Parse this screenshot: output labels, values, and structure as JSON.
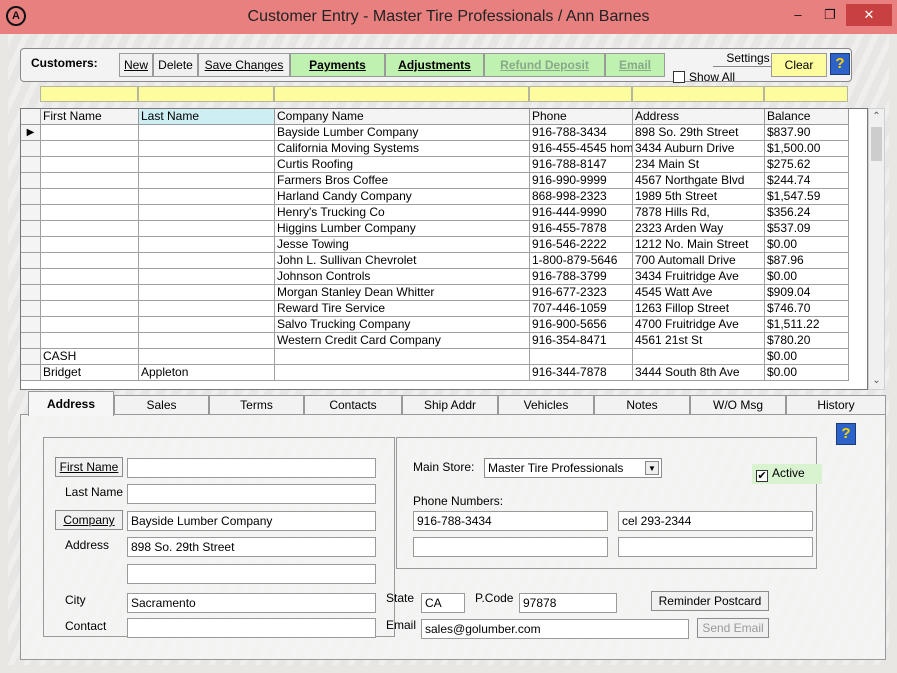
{
  "window": {
    "title": "Customer Entry - Master Tire Professionals / Ann Barnes",
    "app_icon": "A",
    "minimize": "–",
    "maximize": "❐",
    "close": "✕"
  },
  "toolbar": {
    "customers_label": "Customers:",
    "new": "New",
    "delete": "Delete",
    "save_changes": "Save Changes",
    "payments": "Payments",
    "adjustments": "Adjustments",
    "refund_deposit": "Refund Deposit",
    "email": "Email",
    "settings": "Settings",
    "show_all": "Show All",
    "clear": "Clear",
    "help": "?"
  },
  "grid": {
    "columns": [
      "",
      "First Name",
      "Last Name",
      "Company Name",
      "Phone",
      "Address",
      "Balance"
    ],
    "current_row_marker": "▶",
    "rows": [
      {
        "first": "",
        "last": "",
        "company": "Bayside Lumber Company",
        "phone": "916-788-3434",
        "address": "898 So. 29th Street",
        "balance": "$837.90"
      },
      {
        "first": "",
        "last": "",
        "company": "California Moving Systems",
        "phone": "916-455-4545 hom",
        "address": "3434 Auburn Drive",
        "balance": "$1,500.00"
      },
      {
        "first": "",
        "last": "",
        "company": "Curtis Roofing",
        "phone": "916-788-8147",
        "address": "234 Main St",
        "balance": "$275.62"
      },
      {
        "first": "",
        "last": "",
        "company": "Farmers Bros Coffee",
        "phone": "916-990-9999",
        "address": "4567 Northgate Blvd",
        "balance": "$244.74"
      },
      {
        "first": "",
        "last": "",
        "company": "Harland Candy Company",
        "phone": "868-998-2323",
        "address": "1989 5th Street",
        "balance": "$1,547.59"
      },
      {
        "first": "",
        "last": "",
        "company": "Henry's Trucking  Co",
        "phone": "916-444-9990",
        "address": "7878 Hills Rd,",
        "balance": "$356.24"
      },
      {
        "first": "",
        "last": "",
        "company": "Higgins Lumber Company",
        "phone": "916-455-7878",
        "address": "2323 Arden Way",
        "balance": "$537.09"
      },
      {
        "first": "",
        "last": "",
        "company": "Jesse Towing",
        "phone": "916-546-2222",
        "address": "1212 No. Main Street",
        "balance": "$0.00"
      },
      {
        "first": "",
        "last": "",
        "company": "John L. Sullivan Chevrolet",
        "phone": "1-800-879-5646",
        "address": "700 Automall Drive",
        "balance": "$87.96"
      },
      {
        "first": "",
        "last": "",
        "company": "Johnson Controls",
        "phone": "916-788-3799",
        "address": "3434 Fruitridge Ave",
        "balance": "$0.00"
      },
      {
        "first": "",
        "last": "",
        "company": "Morgan Stanley Dean Whitter",
        "phone": "916-677-2323",
        "address": "4545 Watt Ave",
        "balance": "$909.04"
      },
      {
        "first": "",
        "last": "",
        "company": "Reward Tire Service",
        "phone": "707-446-1059",
        "address": "1263 Fillop Street",
        "balance": "$746.70"
      },
      {
        "first": "",
        "last": "",
        "company": "Salvo Trucking Company",
        "phone": "916-900-5656",
        "address": "4700 Fruitridge Ave",
        "balance": "$1,511.22"
      },
      {
        "first": "",
        "last": "",
        "company": "Western Credit Card Company",
        "phone": "916-354-8471",
        "address": "4561 21st St",
        "balance": "$780.20"
      },
      {
        "first": "CASH",
        "last": "",
        "company": "",
        "phone": "",
        "address": "",
        "balance": "$0.00"
      },
      {
        "first": "Bridget",
        "last": "Appleton",
        "company": "",
        "phone": "916-344-7878",
        "address": "3444 South 8th Ave",
        "balance": "$0.00"
      }
    ]
  },
  "tabs": [
    "Address",
    "Sales",
    "Terms",
    "Contacts",
    "Ship Addr",
    "Vehicles",
    "Notes",
    "W/O Msg",
    "History"
  ],
  "address_form": {
    "first_name_btn": "First Name",
    "last_name_label": "Last Name",
    "company_btn": "Company",
    "address_label": "Address",
    "city_label": "City",
    "contact_label": "Contact",
    "state_label": "State",
    "pcode_label": "P.Code",
    "email_label": "Email",
    "main_store_label": "Main Store:",
    "phone_numbers_label": "Phone Numbers:",
    "active_label": "Active",
    "reminder_postcard": "Reminder Postcard",
    "send_email": "Send Email",
    "values": {
      "first_name": "",
      "last_name": "",
      "company": "Bayside Lumber Company",
      "address1": "898 So. 29th Street",
      "address2": "",
      "city": "Sacramento",
      "contact": "",
      "state": "CA",
      "pcode": "97878",
      "email": "sales@golumber.com",
      "main_store": "Master Tire Professionals",
      "phone1": "916-788-3434",
      "phone2": "cel 293-2344",
      "phone3": "",
      "phone4": "",
      "active_mark": "✔"
    }
  }
}
